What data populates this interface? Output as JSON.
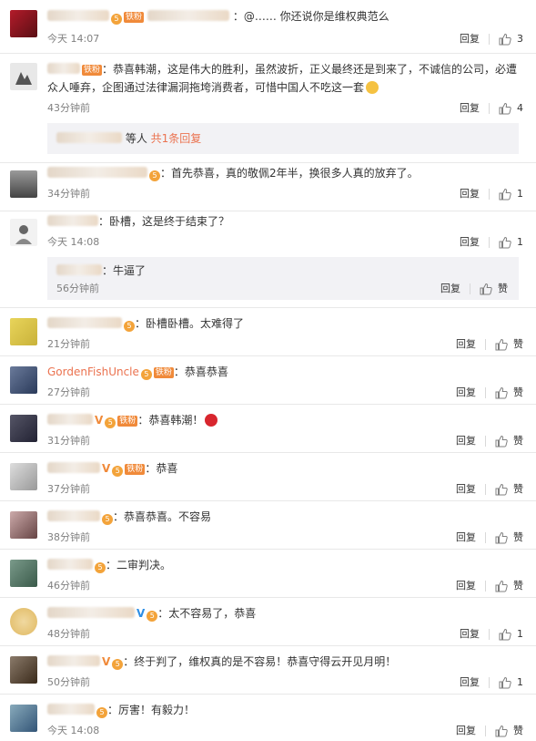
{
  "labels": {
    "reply": "回复",
    "like": "赞",
    "tiefen": "铁粉",
    "vip": "5"
  },
  "comments": [
    {
      "name": "",
      "text": "：@…… 你还说你是维权典范么",
      "time": "今天 14:07",
      "likes": "3"
    },
    {
      "name": "",
      "text": "：恭喜韩潮，这是伟大的胜利，虽然波折，正义最终还是到来了，不诚信的公司，必遭众人唾弃，企图通过法律漏洞拖垮消费者，可惜中国人不吃这一套",
      "time": "43分钟前",
      "likes": "4",
      "sub_summary": {
        "suffix": "等人",
        "link": "共1条回复"
      }
    },
    {
      "name": "",
      "text": "：首先恭喜，真的敬佩2年半，换很多人真的放弃了。",
      "time": "34分钟前",
      "likes": "1"
    },
    {
      "name": "",
      "text": "：卧槽，这是终于结束了？",
      "time": "今天 14:08",
      "likes": "1",
      "sub_reply": {
        "name": "",
        "text": "：牛逼了",
        "time": "56分钟前"
      }
    },
    {
      "name": "",
      "text": "：卧槽卧槽。太难得了",
      "time": "21分钟前",
      "likes": ""
    },
    {
      "name": "GordenFishUncle",
      "text": "：恭喜恭喜",
      "time": "27分钟前",
      "likes": ""
    },
    {
      "name": "",
      "text": "：恭喜韩潮！",
      "time": "31分钟前",
      "likes": ""
    },
    {
      "name": "",
      "text": "：恭喜",
      "time": "37分钟前",
      "likes": ""
    },
    {
      "name": "",
      "text": "：恭喜恭喜。不容易",
      "time": "38分钟前",
      "likes": ""
    },
    {
      "name": "",
      "text": "：二审判决。",
      "time": "46分钟前",
      "likes": ""
    },
    {
      "name": "",
      "text": "：太不容易了，恭喜",
      "time": "48分钟前",
      "likes": "1"
    },
    {
      "name": "",
      "text": "：终于判了，维权真的是不容易！恭喜守得云开见月明！",
      "time": "50分钟前",
      "likes": "1"
    },
    {
      "name": "",
      "text": "：厉害！有毅力！",
      "time": "今天 14:08",
      "likes": ""
    }
  ],
  "colors": {
    "username": "#eb7350",
    "tiefen": "#f08a3a",
    "meta": "#808080",
    "sub_bg": "#f2f2f5"
  }
}
